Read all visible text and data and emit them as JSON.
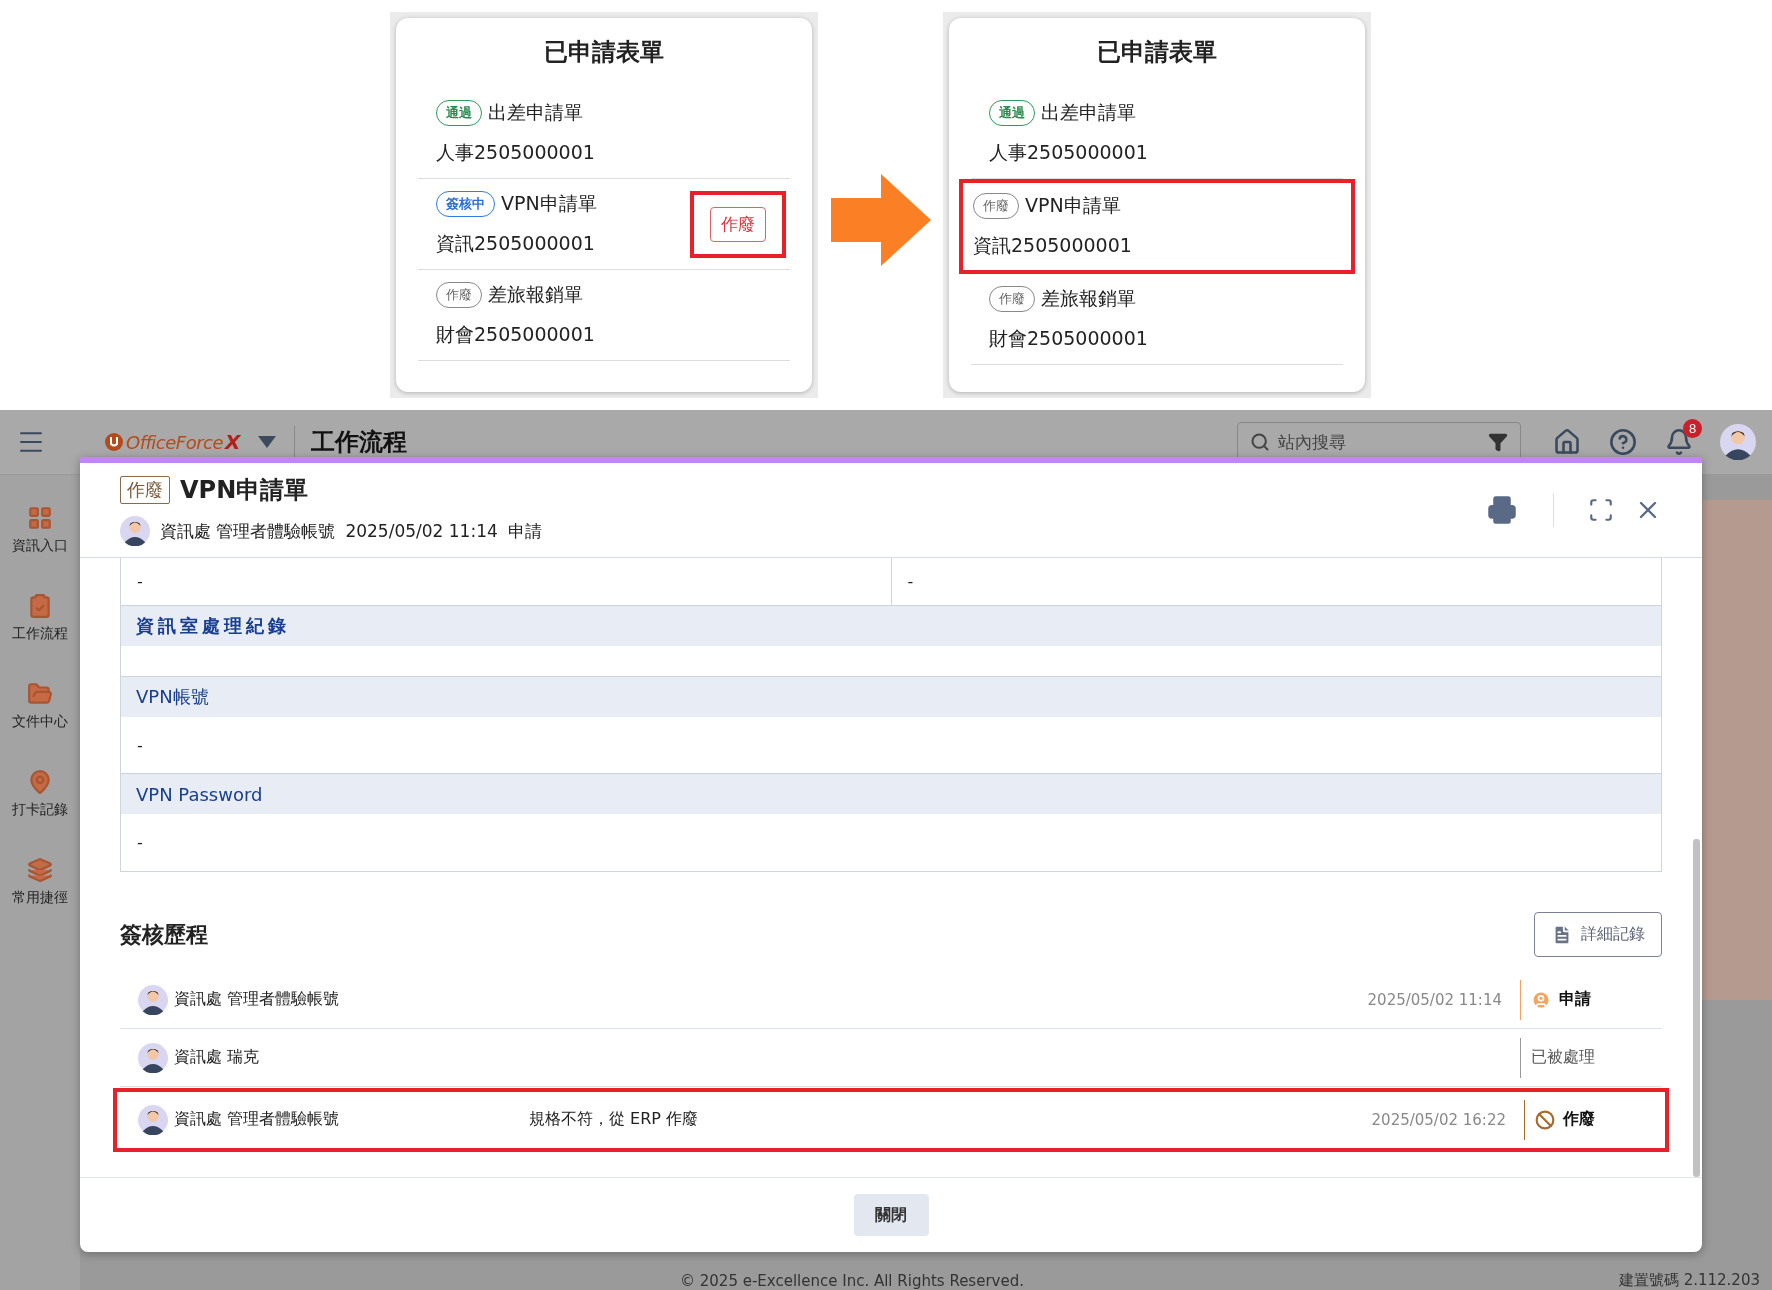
{
  "comparison": {
    "panels": [
      {
        "title": "已申請表單",
        "items": [
          {
            "status": "通過",
            "kind": "approved",
            "name": "出差申請單",
            "number": "人事2505000001",
            "highlighted": false
          },
          {
            "status": "簽核中",
            "kind": "signing",
            "name": "VPN申請單",
            "number": "資訊2505000001",
            "highlighted": false,
            "action": "作廢",
            "action_highlighted": true
          },
          {
            "status": "作廢",
            "kind": "void",
            "name": "差旅報銷單",
            "number": "財會2505000001",
            "highlighted": false
          }
        ]
      },
      {
        "title": "已申請表單",
        "items": [
          {
            "status": "通過",
            "kind": "approved",
            "name": "出差申請單",
            "number": "人事2505000001",
            "highlighted": false
          },
          {
            "status": "作廢",
            "kind": "void",
            "name": "VPN申請單",
            "number": "資訊2505000001",
            "highlighted": true
          },
          {
            "status": "作廢",
            "kind": "void",
            "name": "差旅報銷單",
            "number": "財會2505000001",
            "highlighted": false
          }
        ]
      }
    ]
  },
  "app": {
    "topbar": {
      "logo": {
        "name": "OfficeForce",
        "mark": "X"
      },
      "module": "工作流程",
      "search_placeholder": "站內搜尋",
      "notifications": "8"
    },
    "sidebar": [
      {
        "label": "資訊入口",
        "kind": "portal"
      },
      {
        "label": "工作流程",
        "kind": "workflow"
      },
      {
        "label": "文件中心",
        "kind": "documents"
      },
      {
        "label": "打卡記錄",
        "kind": "clock"
      },
      {
        "label": "常用捷徑",
        "kind": "shortcuts"
      }
    ],
    "dialog": {
      "status": "作廢",
      "title": "VPN申請單",
      "applicant": "資訊處 管理者體驗帳號",
      "time": "2025/05/02 11:14",
      "action": "申請",
      "form": {
        "row": [
          "-",
          "-"
        ],
        "sections": [
          {
            "label": "資訊室處理紀錄",
            "spaced": true
          },
          {
            "label": "VPN帳號",
            "spaced": false,
            "value": "-"
          },
          {
            "label": "VPN Password",
            "spaced": false,
            "value": "-"
          }
        ]
      },
      "history": {
        "title": "簽核歷程",
        "detail_button": "詳細記錄",
        "rows": [
          {
            "name": "資訊處 管理者體驗帳號",
            "time": "2025/05/02 11:14",
            "action": "申請",
            "kind": "apply",
            "highlighted": false
          },
          {
            "name": "資訊處 瑞克",
            "action": "已被處理",
            "kind": "processed",
            "highlighted": false
          },
          {
            "name": "資訊處 管理者體驗帳號",
            "comment": "規格不符，從 ERP 作廢",
            "time": "2025/05/02 16:22",
            "action": "作廢",
            "kind": "void",
            "highlighted": true
          }
        ]
      },
      "close_button": "關閉"
    },
    "footer": {
      "copyright": "© 2025 e-Excellence Inc. All Rights Reserved.",
      "build": "建置號碼 2.112.203"
    }
  }
}
